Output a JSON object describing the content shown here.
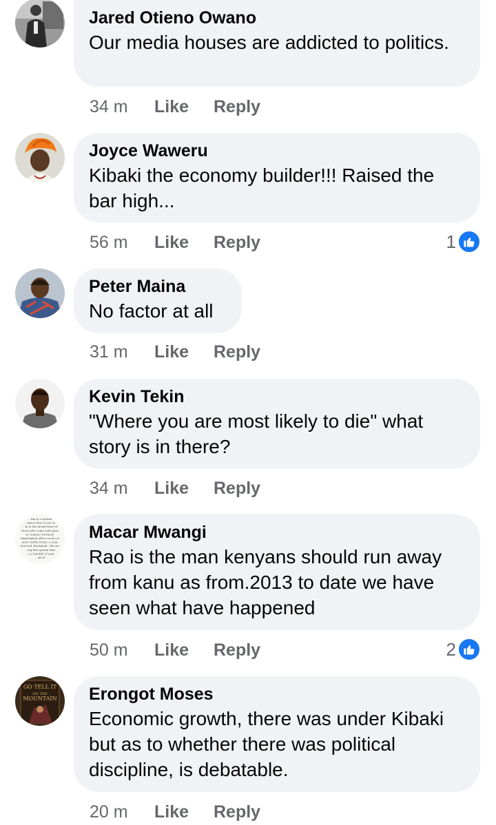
{
  "comments": [
    {
      "author": "Jared Otieno Owano",
      "text": "Our media houses are addicted to politics.",
      "time": "34 m",
      "like_label": "Like",
      "reply_label": "Reply",
      "avatar_icon": "man-standing-photo-avatar"
    },
    {
      "author": "Joyce Waweru",
      "text": "Kibaki  the economy builder!!!  Raised the bar high...",
      "time": "56 m",
      "like_label": "Like",
      "reply_label": "Reply",
      "reaction_count": "1",
      "avatar_icon": "woman-orange-headwrap-avatar"
    },
    {
      "author": "Peter Maina",
      "text": "No factor at all",
      "time": "31 m",
      "like_label": "Like",
      "reply_label": "Reply",
      "avatar_icon": "man-portrait-avatar"
    },
    {
      "author": "Kevin Tekin",
      "text": "\"Where you are most likely to die\" what story is in there?",
      "time": "34 m",
      "like_label": "Like",
      "reply_label": "Reply",
      "avatar_icon": "man-portrait-avatar"
    },
    {
      "author": "Macar Mwangi",
      "text": "Rao is the man kenyans should run away from kanu as from.2013 to date we have seen  what have happened",
      "time": "50 m",
      "like_label": "Like",
      "reply_label": "Reply",
      "reaction_count": "2",
      "avatar_icon": "text-image-avatar"
    },
    {
      "author": "Erongot Moses",
      "text": "Economic growth, there was under Kibaki but as to whether there was political discipline, is debatable.",
      "time": "20 m",
      "like_label": "Like",
      "reply_label": "Reply",
      "avatar_icon": "book-cover-avatar"
    }
  ],
  "colors": {
    "bubble_bg": "#f0f2f5",
    "meta_text": "#65676b",
    "like_badge": "#1877f2"
  },
  "avatar_texts": {
    "macar": [
      "...ism is a system",
      "...tation that occurs in",
      "...ly in the brutal form of",
      "those who come with guns",
      "to conquer territory.",
      "Imperialism often occurs in",
      "more subtle forms, a loan,",
      "food aid, blackmail . We are",
      "...ing this system that",
      "...s a handful of men",
      "...all of"
    ],
    "erongot": [
      "GO TELL IT",
      "ON THE",
      "MOUNTAIN"
    ]
  }
}
